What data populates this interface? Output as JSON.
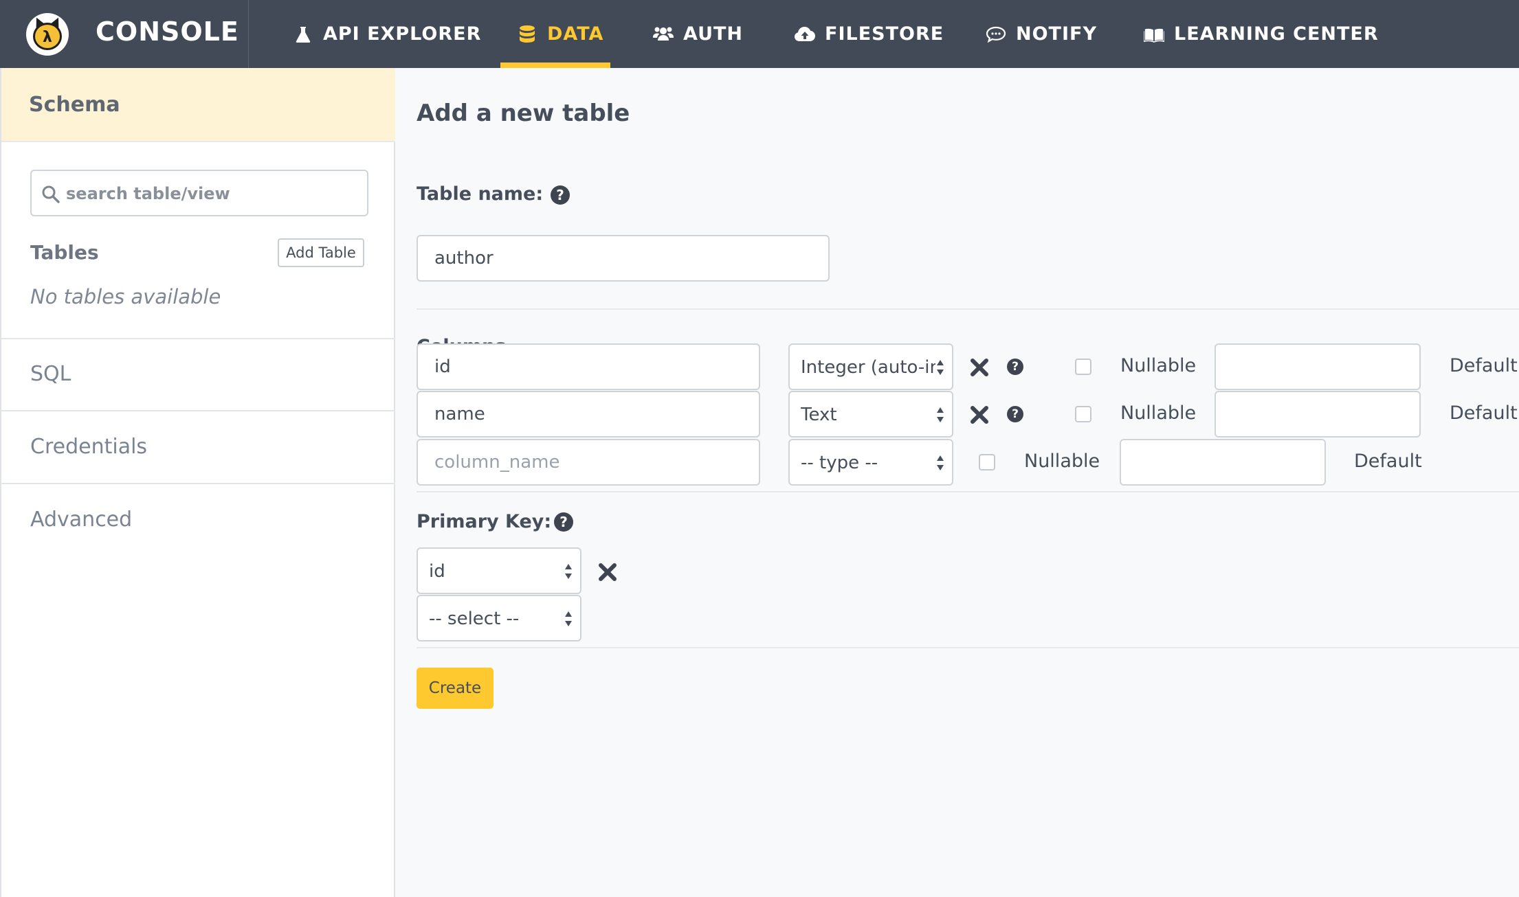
{
  "header": {
    "brand": "CONSOLE",
    "nav": [
      {
        "label": "API EXPLORER",
        "icon": "flask-icon"
      },
      {
        "label": "DATA",
        "icon": "database-icon",
        "active": true
      },
      {
        "label": "AUTH",
        "icon": "users-icon"
      },
      {
        "label": "FILESTORE",
        "icon": "cloud-upload-icon"
      },
      {
        "label": "NOTIFY",
        "icon": "comment-icon"
      },
      {
        "label": "LEARNING CENTER",
        "icon": "book-icon"
      }
    ],
    "accent_color": "#fec92f",
    "background_color": "#424957"
  },
  "sidebar": {
    "schema_title": "Schema",
    "search_placeholder": "search table/view",
    "tables_label": "Tables",
    "add_table_label": "Add Table",
    "no_tables_text": "No tables available",
    "links": [
      "SQL",
      "Credentials",
      "Advanced"
    ]
  },
  "main": {
    "title": "Add a new table",
    "table_name_label": "Table name:",
    "table_name_value": "author",
    "columns_label": "Columns",
    "columns": [
      {
        "name": "id",
        "type": "Integer (auto-increment)",
        "nullable": false,
        "nullable_label": "Nullable",
        "default_label": "Default"
      },
      {
        "name": "name",
        "type": "Text",
        "nullable": false,
        "nullable_label": "Nullable",
        "default_label": "Default"
      }
    ],
    "new_column": {
      "placeholder": "column_name",
      "type_placeholder": "-- type --",
      "nullable_label": "Nullable",
      "default_label": "Default"
    },
    "primary_key_label": "Primary Key:",
    "primary_keys": [
      "id"
    ],
    "primary_key_select_placeholder": "-- select --",
    "create_label": "Create"
  }
}
